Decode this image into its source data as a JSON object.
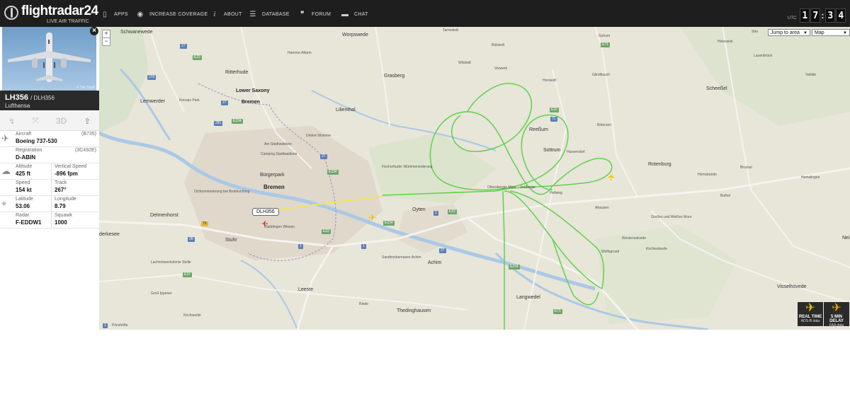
{
  "brand": {
    "name": "flightradar24",
    "tagline": "LIVE AIR TRAFFIC"
  },
  "nav": [
    {
      "label": "APPS",
      "icon": "mobile-phone-icon"
    },
    {
      "label": "INCREASE COVERAGE",
      "icon": "eye-icon"
    },
    {
      "label": "ABOUT",
      "icon": "info-icon"
    },
    {
      "label": "DATABASE",
      "icon": "database-icon"
    },
    {
      "label": "FORUM",
      "icon": "quote-icon"
    },
    {
      "label": "CHAT",
      "icon": "chat-bubble-icon"
    }
  ],
  "clock": {
    "utc_label": "UTC",
    "h1": "1",
    "h2": "7",
    "m1": "3",
    "m2": "4",
    "sep": ":"
  },
  "flight": {
    "callsign": "LH356",
    "icao_callsign": "/ DLH356",
    "airline": "Lufthansa",
    "photo_credit": "© Tim Stadt",
    "aircraft_label": "Aircraft",
    "aircraft_code": "(B735)",
    "aircraft_value": "Boeing 737-530",
    "registration_label": "Registration",
    "registration_code": "(3C492E)",
    "registration_value": "D-ABIN",
    "altitude_label": "Altitude",
    "altitude_value": "425 ft",
    "vspeed_label": "Vertical Speed",
    "vspeed_value": "-896 fpm",
    "speed_label": "Speed",
    "speed_value": "154 kt",
    "track_label": "Track",
    "track_value": "267°",
    "lat_label": "Latitude",
    "lat_value": "53.06",
    "lon_label": "Longitude",
    "lon_value": "8.79",
    "radar_label": "Radar",
    "radar_value": "F-EDDW1",
    "squawk_label": "Squawk",
    "squawk_value": "1000",
    "tool_3d": "3D"
  },
  "map": {
    "zoom_in": "+",
    "zoom_out": "−",
    "jump_to_area": "Jump to area",
    "map_type": "Map",
    "street_label": "Stre",
    "flight_label": "DLH356",
    "colors": {
      "track_green": "#5fd24a",
      "track_yellow": "#f0e36a",
      "water": "#aac9e6",
      "road": "#f5f3ee"
    },
    "places": {
      "schwanewede": "Schwanewede",
      "worpswede": "Worpswede",
      "tarmstedt": "Tarmstedt",
      "gyhum": "Gyhum",
      "buelstedt": "Bülstedt",
      "wilstedt": "Wilstedt",
      "vorwerk": "Vorwerk",
      "ritterhude": "Ritterhude",
      "lower_saxony": "Lower Saxony",
      "bremen_state": "Bremen",
      "grasberg": "Grasberg",
      "horstedt": "Horstedt",
      "glindbusch": "Glindbusch",
      "lemwerder": "Lemwerder",
      "lilienthal": "Lilienthal",
      "reessum": "Reeßum",
      "boetersen": "Bötersen",
      "scheessel": "Scheeßel",
      "lauenbrueck": "Lauenbrück",
      "vahlde": "Vahlde",
      "helvesiek": "Helvesiek",
      "sottrum": "Sottrum",
      "hassendorf": "Hassendorf",
      "rotenburg": "Rotenburg",
      "hemsbuende": "Hemsbünde",
      "brockel": "Brockel",
      "hemslingen": "Hemslingen",
      "bremen": "Bremen",
      "buergerpark": "Bürgerpark",
      "delmenhorst": "Delmenhorst",
      "oyten": "Oyten",
      "hellweg": "Hellweg",
      "ahausen": "Ahausen",
      "bothel": "Bothel",
      "stuhr": "Stuhr",
      "westerwalsede": "Westerwalsede",
      "kirchwalsede": "Kirchwalsede",
      "achim": "Achim",
      "leeste": "Leeste",
      "riede": "Riede",
      "thedinghausen": "Thedinghausen",
      "langwedel": "Langwedel",
      "visselhoevede": "Visselhövede",
      "kirchseelte": "Kirchseelte",
      "prinzhoefte": "Prinzhöfte",
      "ganderkesee": "derkesee",
      "nei": "Nei",
      "vossberge": "Voßberge",
      "wolfsgrund": "Wolfsgrund",
      "grosses_moor": "Großes und Weißes Moor",
      "fischerhuder": "Fischerhuder Wümmeniederung",
      "am_stadtwaldsee": "Am Stadtwaldsee",
      "unterewuemme": "Untere Wümme",
      "ochtumniederung": "Ochtumniederung bei Brokhuchting",
      "kladdingen": "Kladdingen Wiesen",
      "sandtrockenrasen": "Sandtrockenrasen Achim",
      "lachmoewenkolonie": "Lachmöwenkolonie Stelle",
      "gross_ippener": "Groß Ippener",
      "hamme_altarm": "Hamme-Altarm",
      "knoops_park": "Knoops Park",
      "camping": "Camping Stadtwaldsee",
      "otterstedter_moor": "Ottersberger Moor"
    },
    "shields": [
      "270",
      "27",
      "281",
      "27",
      "E22",
      "E234",
      "E234",
      "E22",
      "27",
      "28",
      "75",
      "E37",
      "E22",
      "27",
      "E234",
      "E234",
      "E71",
      "71",
      "E22",
      "E71",
      "1",
      "1",
      "1",
      "1"
    ],
    "legend": [
      {
        "title": "REAL TIME",
        "sub": "ADS-B data"
      },
      {
        "title": "5 MIN DELAY",
        "sub": "FAA data"
      }
    ]
  }
}
